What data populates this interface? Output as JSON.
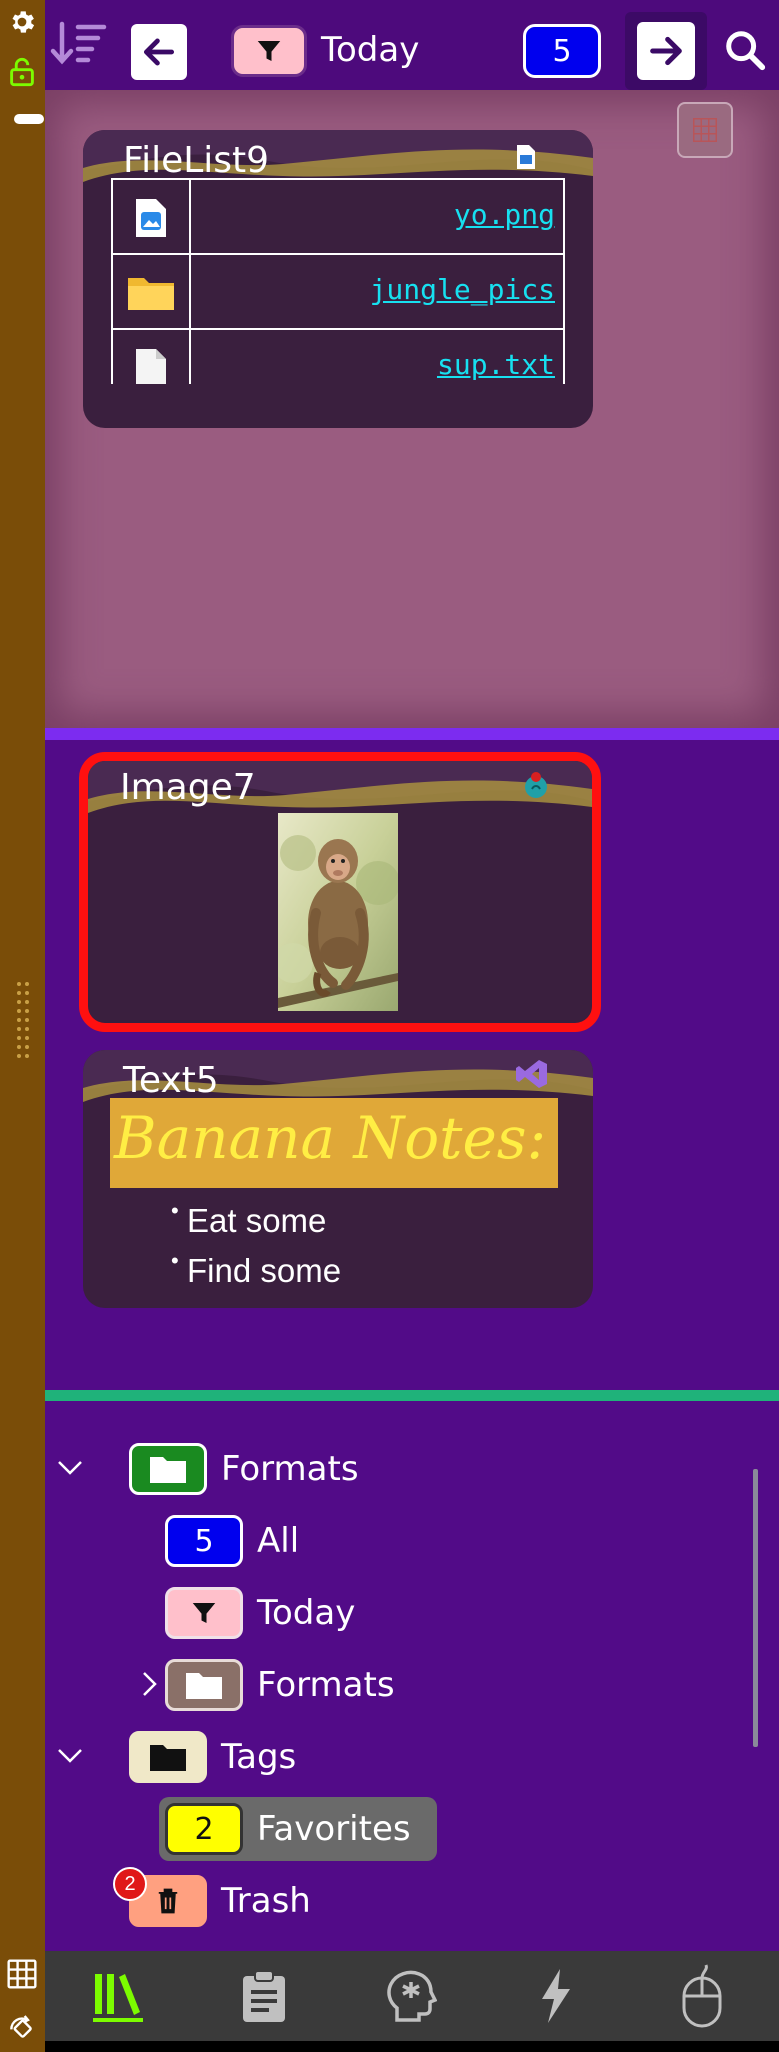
{
  "toolbar": {
    "filter_label": "Today",
    "count_badge": "5"
  },
  "panes": {
    "filelist": {
      "title": "FileList9",
      "files": [
        {
          "name": "yo.png",
          "icon": "image-file-icon"
        },
        {
          "name": "jungle_pics",
          "icon": "folder-icon"
        },
        {
          "name": "sup.txt",
          "icon": "text-file-icon"
        }
      ]
    },
    "image": {
      "title": "Image7",
      "image_subject": "monkey"
    },
    "text": {
      "title": "Text5",
      "banner": "Banana Notes:",
      "bullets": [
        "Eat some",
        "Find some"
      ]
    }
  },
  "tree": {
    "nodes": [
      {
        "label": "Formats",
        "badge": "",
        "icon": "folder-icon"
      },
      {
        "label": "All",
        "badge": "5",
        "icon": ""
      },
      {
        "label": "Today",
        "badge": "",
        "icon": "filter-icon"
      },
      {
        "label": "Formats",
        "badge": "",
        "icon": "folder-icon"
      },
      {
        "label": "Tags",
        "badge": "",
        "icon": "folder-icon"
      },
      {
        "label": "Favorites",
        "badge": "2",
        "icon": ""
      },
      {
        "label": "Trash",
        "badge": "",
        "icon": "trash-icon",
        "notification": "2"
      }
    ]
  },
  "colors": {
    "sidebar": "#7a4d08",
    "toolbar": "#4d0a7c",
    "pane_pink": "#9a5c80",
    "pane_purple": "#520b88",
    "divider_violet": "#7c2cf0",
    "divider_green": "#1fb27a",
    "selection_red": "#ff1010",
    "link_cyan": "#17e0f0",
    "tab_active": "#7cfc00",
    "count_blue": "#0000ee",
    "filter_pink": "#ffc0cb",
    "favorites_yellow": "#ffff00"
  }
}
